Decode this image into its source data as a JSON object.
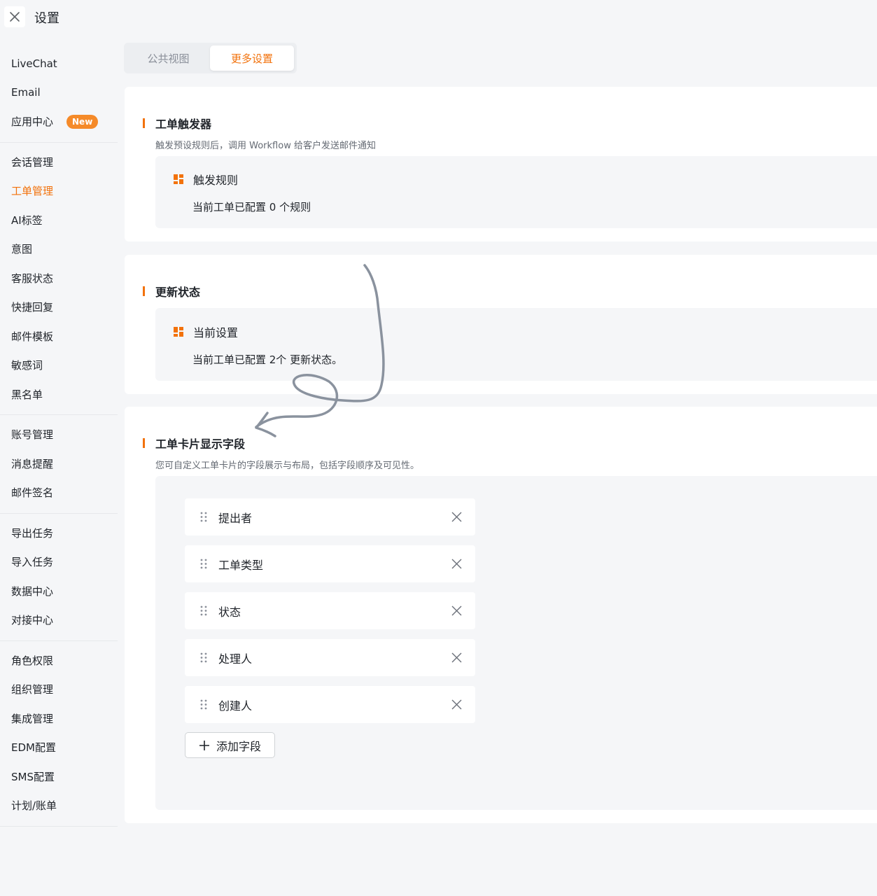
{
  "header": {
    "title": "设置"
  },
  "sidebar": {
    "groups": [
      {
        "items": [
          {
            "label": "LiveChat"
          },
          {
            "label": "Email"
          },
          {
            "label": "应用中心",
            "badge": "New"
          }
        ]
      },
      {
        "items": [
          {
            "label": "会话管理"
          },
          {
            "label": "工单管理",
            "active": true
          },
          {
            "label": "AI标签"
          },
          {
            "label": "意图"
          },
          {
            "label": "客服状态"
          },
          {
            "label": "快捷回复"
          },
          {
            "label": "邮件模板"
          },
          {
            "label": "敏感词"
          },
          {
            "label": "黑名单"
          }
        ]
      },
      {
        "items": [
          {
            "label": "账号管理"
          },
          {
            "label": "消息提醒"
          },
          {
            "label": "邮件签名"
          }
        ]
      },
      {
        "items": [
          {
            "label": "导出任务"
          },
          {
            "label": "导入任务"
          },
          {
            "label": "数据中心"
          },
          {
            "label": "对接中心"
          }
        ]
      },
      {
        "items": [
          {
            "label": "角色权限"
          },
          {
            "label": "组织管理"
          },
          {
            "label": "集成管理"
          },
          {
            "label": "EDM配置"
          },
          {
            "label": "SMS配置"
          },
          {
            "label": "计划/账单"
          }
        ]
      }
    ]
  },
  "tabs": [
    {
      "label": "公共视图"
    },
    {
      "label": "更多设置",
      "active": true
    }
  ],
  "trigger_card": {
    "title": "工单触发器",
    "desc": "触发预设规则后，调用 Workflow 给客户发送邮件通知",
    "box_title": "触发规则",
    "box_text": "当前工单已配置 0 个规则"
  },
  "status_card": {
    "title": "更新状态",
    "box_title": "当前设置",
    "box_text": "当前工单已配置 2个 更新状态。"
  },
  "fields_card": {
    "title": "工单卡片显示字段",
    "desc": "您可自定义工单卡片的字段展示与布局，包括字段顺序及可见性。",
    "fields": [
      "提出者",
      "工单类型",
      "状态",
      "处理人",
      "创建人"
    ],
    "add_label": "添加字段"
  },
  "colors": {
    "accent": "#f2720c",
    "badge": "#f58a29",
    "annotation_stroke": "#8a929e"
  },
  "icons": {
    "close": "close-icon",
    "grid": "grid-icon",
    "drag": "drag-handle-icon",
    "remove": "remove-icon",
    "add": "plus-icon"
  }
}
